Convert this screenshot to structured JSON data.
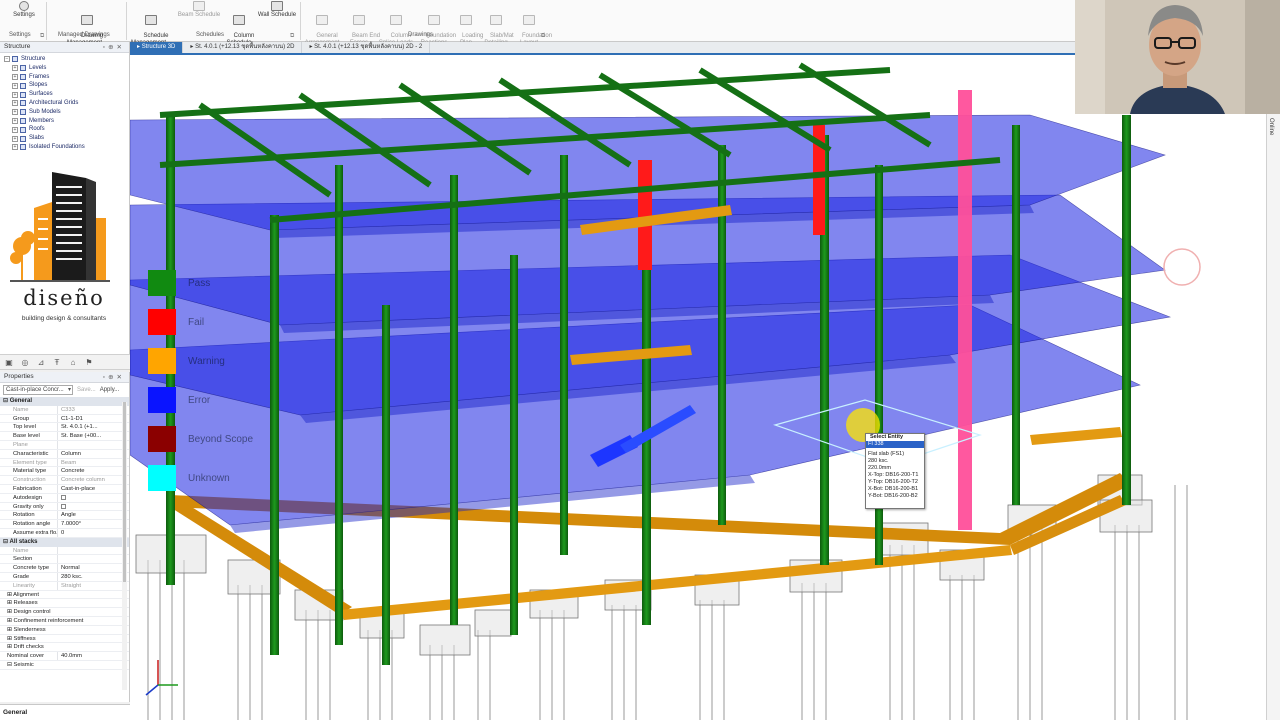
{
  "ribbon": {
    "buttons": [
      {
        "label": "Settings",
        "enabled": true
      },
      {
        "label": "Drawing\nManagement...",
        "enabled": true
      },
      {
        "label": "Schedule\nManagement...",
        "enabled": true
      },
      {
        "label": "Beam Schedule",
        "enabled": false
      },
      {
        "label": "Column\nSchedule",
        "enabled": true
      },
      {
        "label": "Wall Schedule",
        "enabled": true
      },
      {
        "label": "General\nArrangement",
        "enabled": false
      },
      {
        "label": "Beam End\nForces",
        "enabled": false
      },
      {
        "label": "Column\nSplice Loads",
        "enabled": false
      },
      {
        "label": "Foundation\nReactions",
        "enabled": false
      },
      {
        "label": "Loading\nPlan",
        "enabled": false
      },
      {
        "label": "Slab/Mat\nDetailing",
        "enabled": false
      },
      {
        "label": "Foundation\nLayout",
        "enabled": false
      }
    ],
    "groups": [
      "Settings",
      "Managed Drawings",
      "Schedules",
      "Drawings"
    ]
  },
  "tree": {
    "title": "Structure",
    "root": "Structure",
    "items": [
      "Levels",
      "Frames",
      "Slopes",
      "Surfaces",
      "Architectural Grids",
      "Sub Models",
      "Members",
      "Roofs",
      "Slabs",
      "Isolated Foundations"
    ]
  },
  "logo": {
    "word": "diseño",
    "tagline": "building design & consultants"
  },
  "properties": {
    "title": "Properties",
    "selector": "Cast-in-place Concr...",
    "save": "Save...",
    "apply": "Apply...",
    "general_header": "General",
    "rows": [
      {
        "k": "Name",
        "v": "C333",
        "dim": true
      },
      {
        "k": "Group",
        "v": "C1-1-D1"
      },
      {
        "k": "Top level",
        "v": "St. 4.0.1 (+1..."
      },
      {
        "k": "Base level",
        "v": "St. Base (+00..."
      },
      {
        "k": "Plane",
        "v": "",
        "dim": true
      },
      {
        "k": "Characteristic",
        "v": "Column"
      },
      {
        "k": "Element type",
        "v": "Beam",
        "dim": true
      },
      {
        "k": "Material type",
        "v": "Concrete"
      },
      {
        "k": "Construction",
        "v": "Concrete column",
        "dim": true
      },
      {
        "k": "Fabrication",
        "v": "Cast-in-place"
      },
      {
        "k": "Autodesign",
        "v": "",
        "check": true
      },
      {
        "k": "Gravity only",
        "v": "",
        "check": true
      },
      {
        "k": "Rotation",
        "v": "Angle"
      },
      {
        "k": "Rotation angle",
        "v": "7.0000°"
      },
      {
        "k": "Assume extra flo...",
        "v": "0"
      }
    ],
    "stacks_header": "All stacks",
    "stack_rows": [
      {
        "k": "Name",
        "v": "",
        "dim": true
      },
      {
        "k": "Section",
        "v": ""
      },
      {
        "k": "Concrete type",
        "v": "Normal"
      },
      {
        "k": "Grade",
        "v": "280 ksc."
      },
      {
        "k": "Linearity",
        "v": "Straight",
        "dim": true
      }
    ],
    "groups": [
      "Alignment",
      "Releases",
      "Design control",
      "Confinement reinforcement",
      "Slenderness",
      "Stiffness",
      "Drift checks"
    ],
    "nominal_cover_label": "Nominal cover",
    "nominal_cover": "40.0mm",
    "seismic": "Seismic",
    "footer": "General"
  },
  "tabs": [
    {
      "label": "Structure 3D",
      "active": true
    },
    {
      "label": "St. 4.0.1 (+12.13 ชุดพื้นหลังคาบน) 2D",
      "active": false
    },
    {
      "label": "St. 4.0.1 (+12.13 ชุดพื้นหลังคาบน) 2D - 2",
      "active": false
    }
  ],
  "legend": [
    {
      "label": "Pass",
      "color": "#118a11"
    },
    {
      "label": "Fail",
      "color": "#ff0000"
    },
    {
      "label": "Warning",
      "color": "#ffa500"
    },
    {
      "label": "Error",
      "color": "#0a14ff"
    },
    {
      "label": "Beyond Scope",
      "color": "#8b0000"
    },
    {
      "label": "Unknown",
      "color": "#00ffff"
    }
  ],
  "context_menu": {
    "title": "Select Entity",
    "highlight": "FI 338",
    "lines": [
      "Flat slab (FS1)",
      "280 ksc.",
      "220.0mm",
      "X-Top: DB16-200-T1",
      "Y-Top: DB16-200-T2",
      "X-Bot: DB16-200-B1",
      "Y-Bot: DB16-200-B2"
    ]
  },
  "right_strip": "Online",
  "colors": {
    "pass": "#118a11",
    "fail": "#ff0000",
    "warning": "#ffa500",
    "error": "#0a14ff",
    "accent": "#2f6fb5"
  }
}
